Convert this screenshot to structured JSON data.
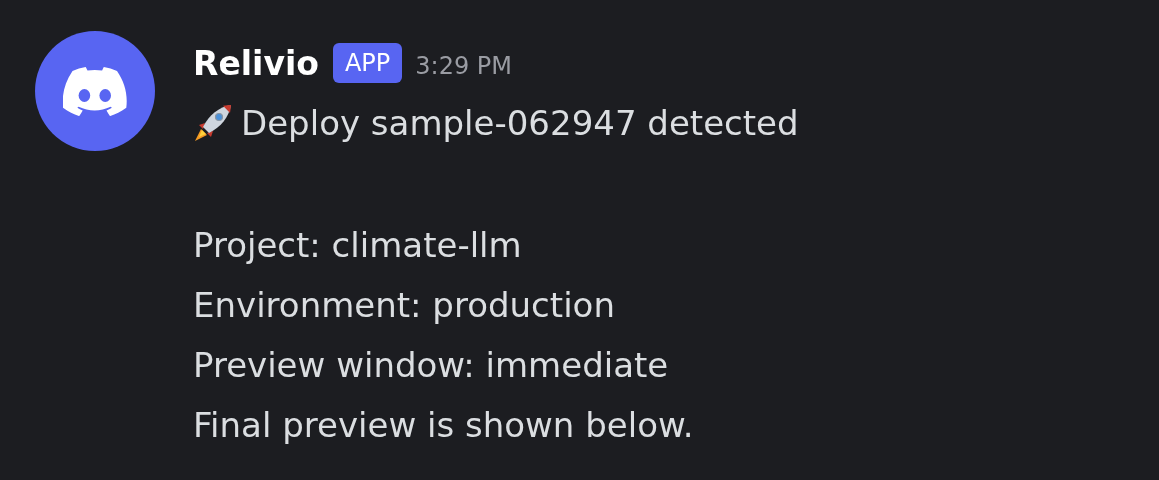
{
  "message": {
    "author": "Relivio",
    "badge": "APP",
    "time": "3:29 PM",
    "title": "Deploy sample-062947 detected",
    "lines": [
      "Project: climate-llm",
      "Environment: production",
      "Preview window: immediate",
      "Final preview is shown below."
    ]
  }
}
